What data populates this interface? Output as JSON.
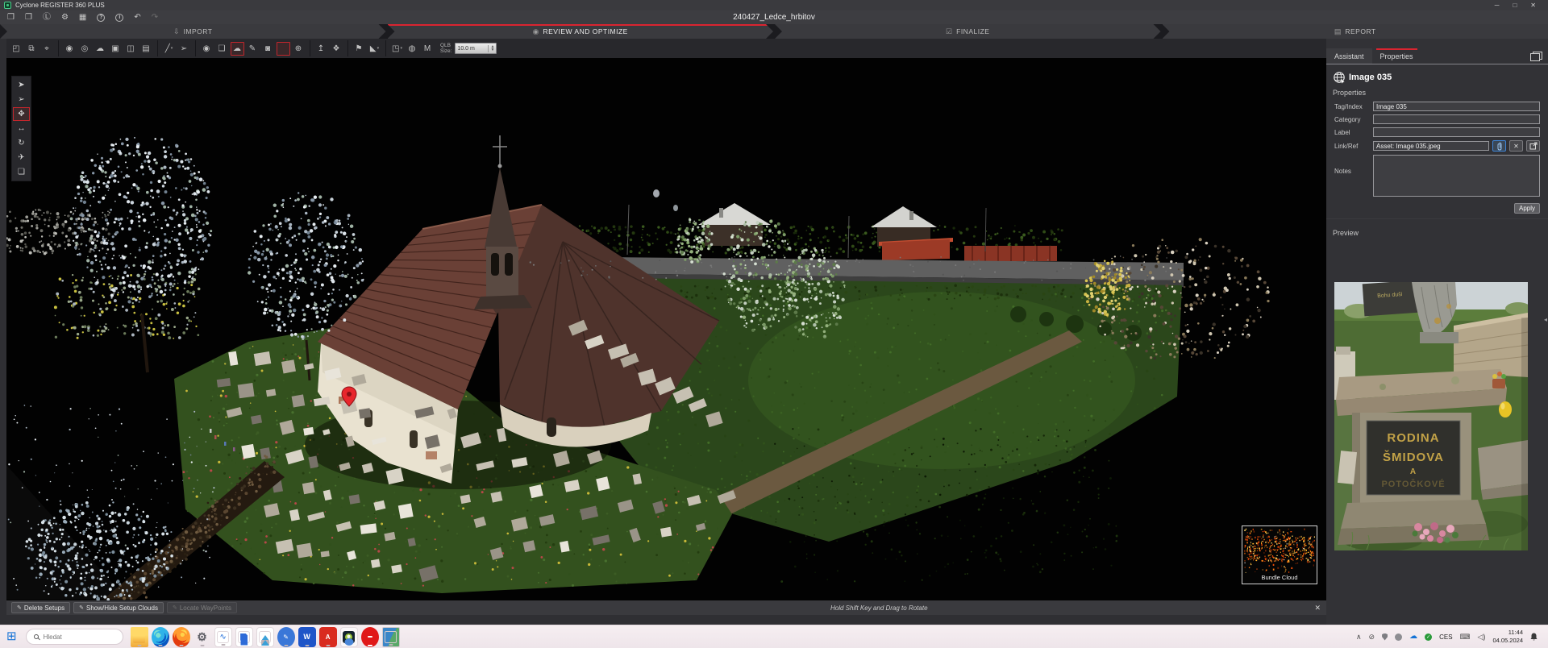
{
  "window": {
    "app_title": "Cyclone REGISTER 360 PLUS",
    "project_title": "240427_Ledce_hrbitov",
    "controls": [
      {
        "name": "minimize-button",
        "glyph": "─"
      },
      {
        "name": "maximize-button",
        "glyph": "□"
      },
      {
        "name": "close-button",
        "glyph": "✕"
      }
    ]
  },
  "menu_icons": [
    {
      "name": "open-project-icon",
      "glyph": "❒"
    },
    {
      "name": "save-project-icon",
      "glyph": "❐"
    },
    {
      "name": "license-icon",
      "glyph": "Ⓛ"
    },
    {
      "name": "settings-gear-icon",
      "glyph": "⚙"
    },
    {
      "name": "delete-icon",
      "glyph": "▦"
    },
    {
      "name": "help-icon",
      "glyph": "?",
      "cls": "circle"
    },
    {
      "name": "info-icon",
      "glyph": "i",
      "cls": "circle"
    },
    {
      "name": "undo-icon",
      "glyph": "↶"
    },
    {
      "name": "redo-icon",
      "glyph": "↷",
      "cls": "dim"
    }
  ],
  "workflow": {
    "accent_color": "#da2430",
    "steps": [
      {
        "name": "workflow-step-import",
        "label": "IMPORT",
        "glyph": "⇩"
      },
      {
        "name": "workflow-step-review",
        "label": "REVIEW AND OPTIMIZE",
        "glyph": "◉",
        "active": true
      },
      {
        "name": "workflow-step-finalize",
        "label": "FINALIZE",
        "glyph": "☑"
      },
      {
        "name": "workflow-step-report",
        "label": "REPORT",
        "glyph": "▤"
      }
    ]
  },
  "toolbar": {
    "qlb_label_line1": "QLB",
    "qlb_label_line2": "Size:",
    "qlb_value": "10.0 m",
    "items": [
      {
        "name": "fit-view-button",
        "glyph": "◰"
      },
      {
        "name": "window-select-button",
        "glyph": "⧉"
      },
      {
        "name": "zoom-pick-button",
        "glyph": "⌖"
      },
      {
        "sep": true
      },
      {
        "name": "setups-view-button",
        "glyph": "◉"
      },
      {
        "name": "sphere-view-button",
        "glyph": "◎"
      },
      {
        "name": "point-cloud-view-button",
        "glyph": "☁"
      },
      {
        "name": "plane-view-button",
        "glyph": "▣"
      },
      {
        "name": "panorama-view-button",
        "glyph": "◫"
      },
      {
        "name": "image-view-button",
        "glyph": "▤"
      },
      {
        "sep": true
      },
      {
        "name": "measure-button",
        "glyph": "╱",
        "dd": "▾"
      },
      {
        "name": "pick-point-button",
        "glyph": "➢"
      },
      {
        "sep": true
      },
      {
        "name": "limit-box-button",
        "glyph": "◉"
      },
      {
        "name": "tag-button",
        "glyph": "❑"
      },
      {
        "name": "geotag-cloud-button",
        "glyph": "☁",
        "active": true
      },
      {
        "name": "annotate-button",
        "glyph": "✎"
      },
      {
        "name": "camera-button",
        "glyph": "◙"
      },
      {
        "name": "waypoint-pin-button",
        "shape": "pin",
        "active": true
      },
      {
        "name": "add-person-button",
        "glyph": "⊕"
      },
      {
        "sep": true
      },
      {
        "name": "axes-button",
        "glyph": "↥"
      },
      {
        "name": "split-view-button",
        "glyph": "❖"
      },
      {
        "sep": true
      },
      {
        "name": "setup-flag-button",
        "glyph": "⚑"
      },
      {
        "name": "cone-button",
        "glyph": "◣",
        "dd": "▾"
      },
      {
        "sep": true
      },
      {
        "name": "view-cube-button",
        "glyph": "◳",
        "dd": "▾"
      },
      {
        "name": "bundle-sphere-button",
        "glyph": "◍"
      },
      {
        "name": "model-space-button",
        "glyph": "M"
      }
    ]
  },
  "left_tools": [
    {
      "name": "select-tool",
      "glyph": "➤"
    },
    {
      "name": "multi-select-tool",
      "glyph": "➢"
    },
    {
      "name": "pan-tool",
      "glyph": "✥",
      "active": true
    },
    {
      "name": "measure-distance-tool",
      "glyph": "↔"
    },
    {
      "name": "orbit-tool",
      "glyph": "↻"
    },
    {
      "name": "fly-tool",
      "glyph": "✈"
    },
    {
      "name": "cube-view-tool",
      "glyph": "❏"
    }
  ],
  "viewport": {
    "bundle_cloud_label": "Bundle Cloud",
    "marker_color": "#e8262c"
  },
  "bottom_bar": {
    "buttons": [
      {
        "name": "delete-setups-button",
        "label": "Delete Setups",
        "glyph": "✎"
      },
      {
        "name": "show-hide-setup-clouds-button",
        "label": "Show/Hide Setup Clouds",
        "glyph": "✎"
      },
      {
        "name": "locate-waypoints-button",
        "label": "Locate WayPoints",
        "glyph": "✎",
        "enabled": false
      }
    ],
    "hint": "Hold Shift Key and Drag to Rotate",
    "close_glyph": "✕"
  },
  "right_panel": {
    "tabs": [
      {
        "name": "tab-assistant",
        "label": "Assistant"
      },
      {
        "name": "tab-properties",
        "label": "Properties",
        "active": true
      }
    ],
    "header_title": "Image 035",
    "section_label": "Properties",
    "fields": {
      "tag_label": "Tag/Index",
      "tag_value": "Image 035",
      "category_label": "Category",
      "category_value": "",
      "label_label": "Label",
      "label_value": "",
      "linkref_label": "Link/Ref",
      "linkref_value": "Asset: Image 035.jpeg",
      "notes_label": "Notes",
      "notes_value": ""
    },
    "apply_label": "Apply",
    "preview_label": "Preview",
    "preview_text": {
      "plaque_small": "Bohu duši",
      "line1": "RODINA",
      "line2": "ŠMIDOVA",
      "line3": "A",
      "line4": "POTOČKOVÉ"
    },
    "collapse_glyph": "◂"
  },
  "taskbar": {
    "search_placeholder": "Hledat",
    "apps": [
      {
        "name": "file-explorer-icon",
        "cls": "ic-folder"
      },
      {
        "name": "edge-icon",
        "cls": "ic-edge"
      },
      {
        "name": "firefox-icon",
        "cls": "ic-firefox"
      },
      {
        "name": "settings-app-icon",
        "cls": "ic-settings",
        "glyph": "⚙"
      },
      {
        "name": "sketch-app-icon",
        "cls": "ic-sketch",
        "glyph": "∿"
      },
      {
        "name": "save-app-icon",
        "cls": "ic-save"
      },
      {
        "name": "photos-app-icon",
        "cls": "ic-photos"
      },
      {
        "name": "pen-app-icon",
        "cls": "ic-pen",
        "glyph": "✎"
      },
      {
        "name": "word-icon",
        "cls": "ic-word",
        "glyph": "W"
      },
      {
        "name": "acrobat-icon",
        "cls": "ic-acrobat",
        "glyph": "A"
      },
      {
        "name": "cyclone-register-icon",
        "cls": "ic-cyclone",
        "active": true
      },
      {
        "name": "leica-icon",
        "cls": "ic-leica"
      },
      {
        "name": "desktop-preview-icon",
        "cls": "ic-desktop"
      }
    ],
    "tray": {
      "chevron": "∧",
      "language": "CES",
      "time": "11:44",
      "date": "04.05.2024",
      "check": "✓",
      "cloud": "☁",
      "blocked": "⊘",
      "keyboard": "⌨",
      "speaker": "◁)"
    }
  }
}
